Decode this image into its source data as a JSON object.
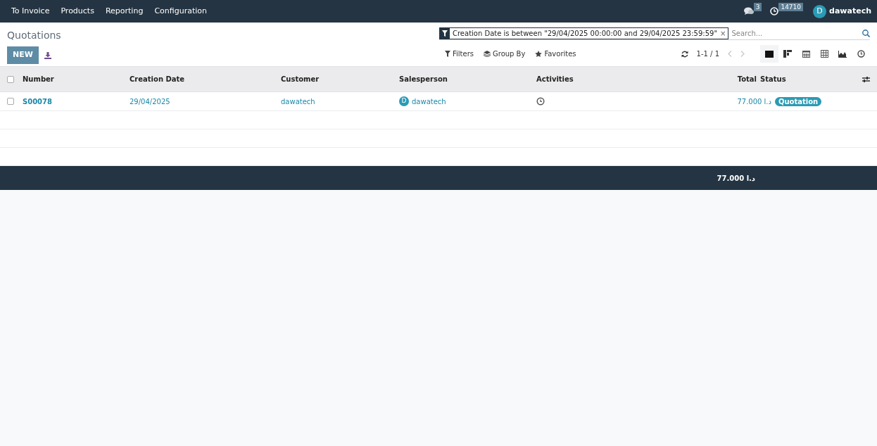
{
  "menu": [
    "To Invoice",
    "Products",
    "Reporting",
    "Configuration"
  ],
  "systray": {
    "messages": "3",
    "activities": "14710",
    "avatar": "D",
    "user": "dawatech"
  },
  "breadcrumb": "Quotations",
  "new_button": "NEW",
  "search": {
    "facet": "Creation Date is between \"29/04/2025 00:00:00 and 29/04/2025 23:59:59\"",
    "facet_remove": "×",
    "placeholder": "Search..."
  },
  "search_options": [
    "Filters",
    "Group By",
    "Favorites"
  ],
  "pager": "1-1 / 1",
  "views": [
    {
      "kind": "list",
      "selected": true
    },
    {
      "kind": "kanban",
      "selected": false
    },
    {
      "kind": "calendar",
      "selected": false
    },
    {
      "kind": "pivot",
      "selected": false
    },
    {
      "kind": "graph",
      "selected": false
    },
    {
      "kind": "activity",
      "selected": false
    }
  ],
  "table": {
    "select_all_checked": false,
    "columns": [
      "Number",
      "Creation Date",
      "Customer",
      "Salesperson",
      "Activities",
      "Total",
      "Status"
    ],
    "rows": [
      {
        "checked": false,
        "number": "S00078",
        "date": "29/04/2025",
        "customer": "dawatech",
        "salesperson_avatar": "D",
        "salesperson": "dawatech",
        "total": "77.000 د.ا",
        "status": "Quotation"
      }
    ],
    "footer_total": "77.000 د.ا"
  }
}
